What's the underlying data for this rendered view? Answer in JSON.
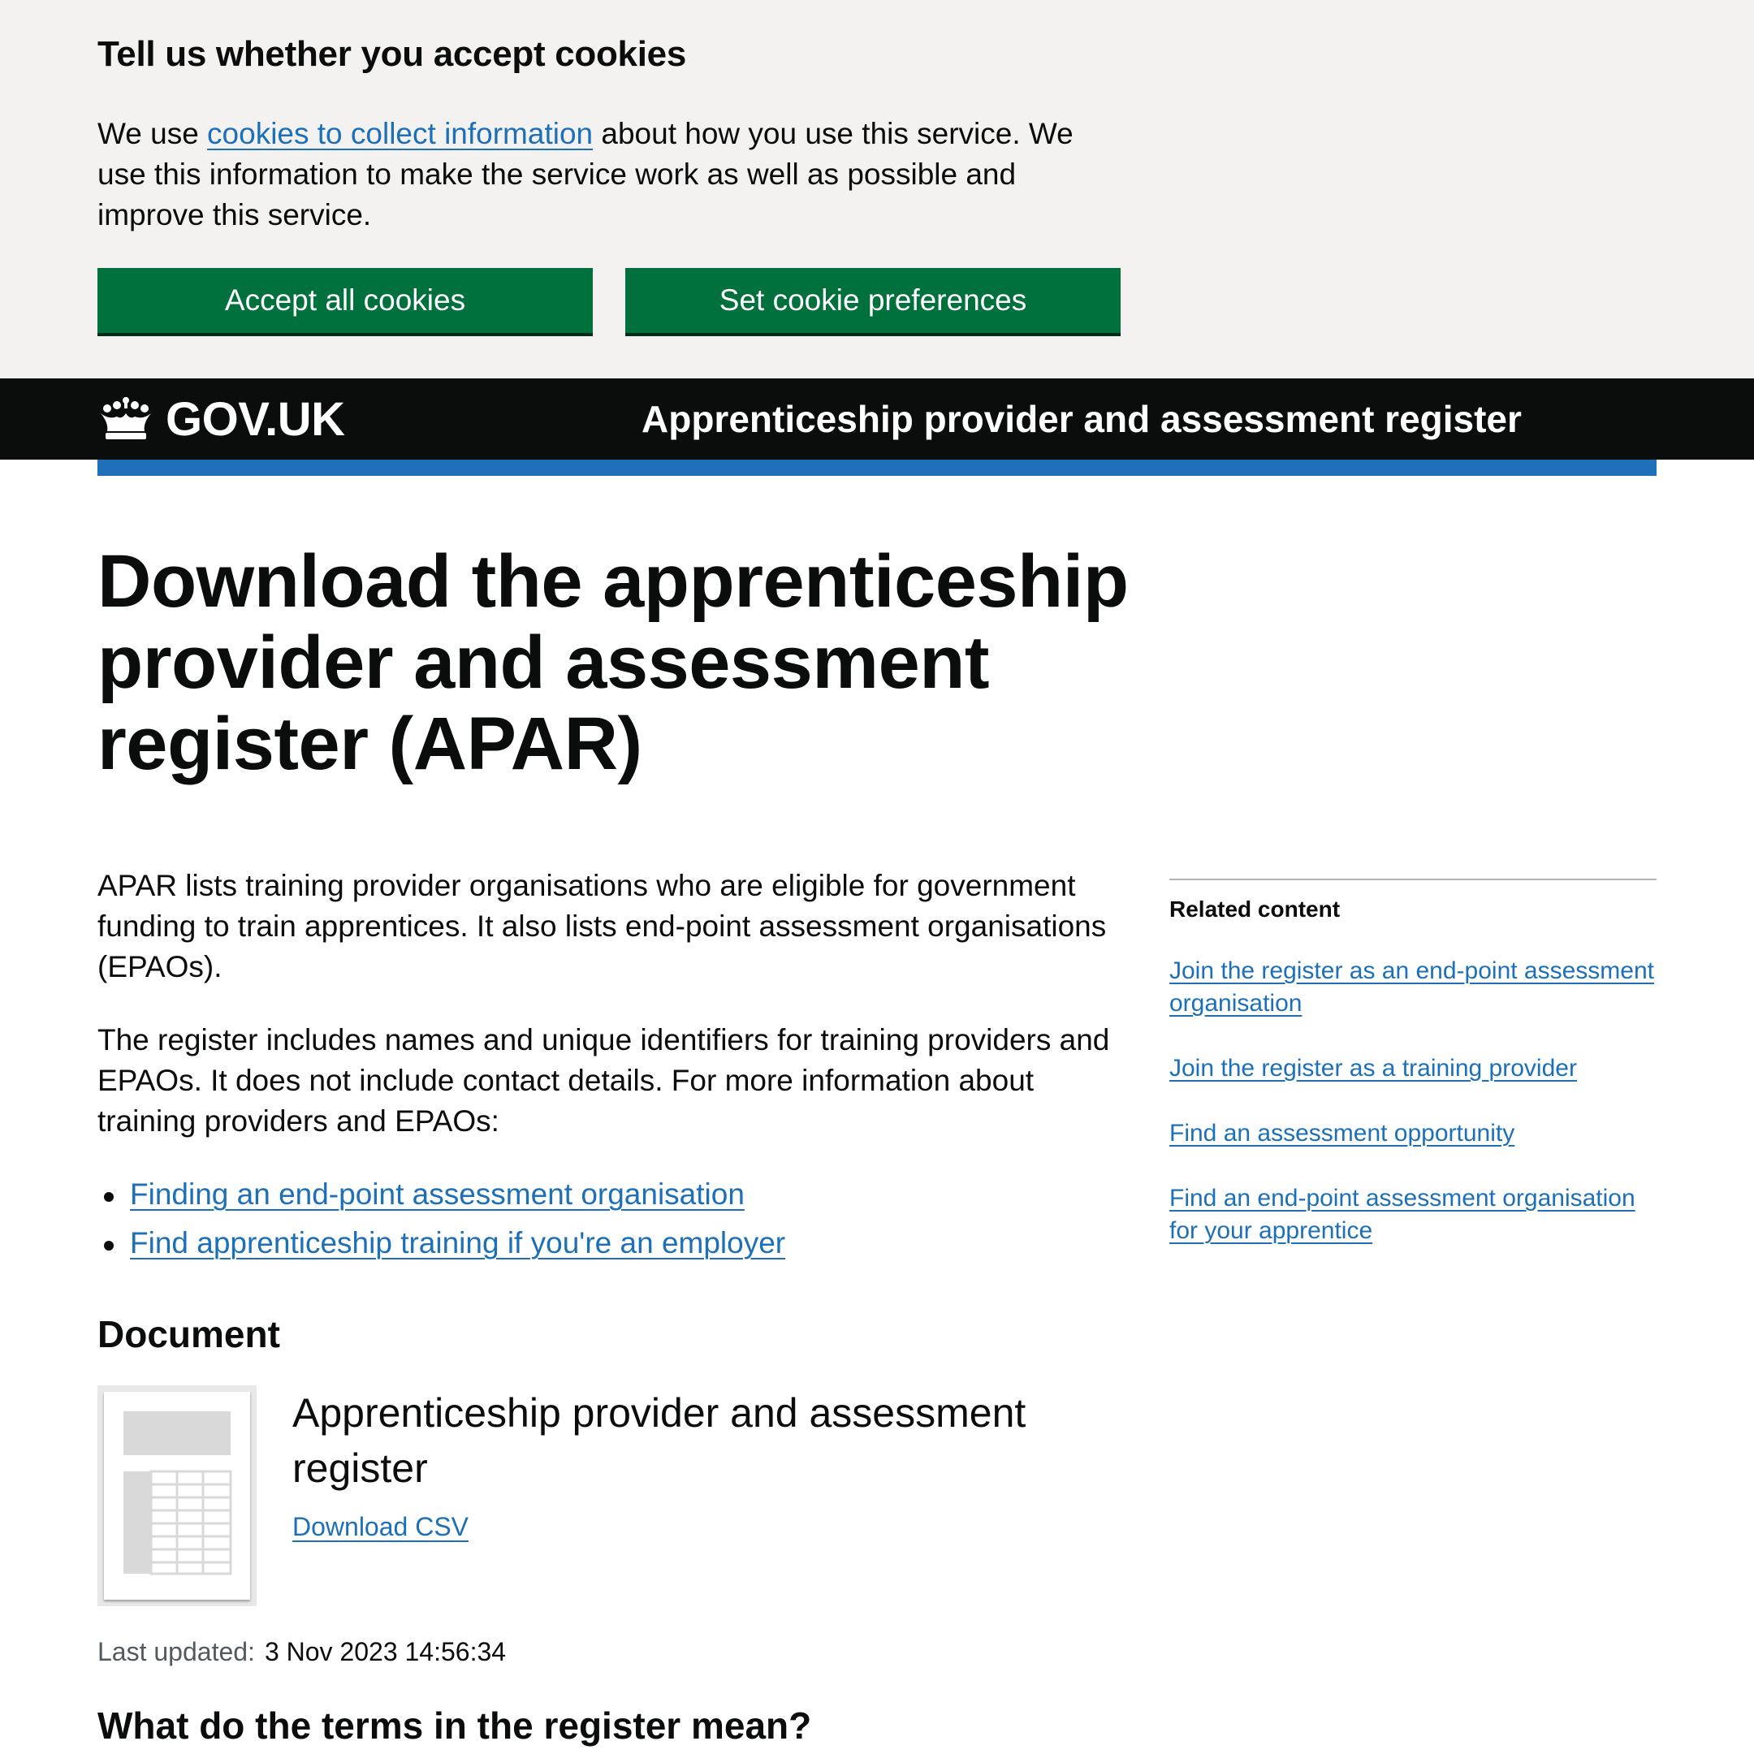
{
  "cookie_banner": {
    "heading": "Tell us whether you accept cookies",
    "text_before": "We use ",
    "link": "cookies to collect information",
    "text_after": " about how you use this service. We use this information to make the service work as well as possible and improve this service.",
    "accept_label": "Accept all cookies",
    "prefs_label": "Set cookie preferences"
  },
  "header": {
    "logo_text": "GOV.UK",
    "service_name": "Apprenticeship provider and assessment register"
  },
  "main": {
    "title": "Download the apprenticeship provider and assessment register (APAR)",
    "para1": "APAR lists training provider organisations who are eligible for government funding to train apprentices. It also lists end-point assessment organisations (EPAOs).",
    "para2": "The register includes names and unique identifiers for training providers and EPAOs. It does not include contact details. For more information about training providers and EPAOs:",
    "links": [
      "Finding an end-point assessment organisation",
      "Find apprenticeship training if you're an employer"
    ],
    "document_heading": "Document",
    "document_title": "Apprenticeship provider and assessment register",
    "download_label": "Download CSV",
    "last_updated_label": "Last updated:",
    "last_updated_value": "3 Nov 2023 14:56:34",
    "terms_heading": "What do the terms in the register mean?"
  },
  "sidebar": {
    "heading": "Related content",
    "links": [
      "Join the register as an end-point assessment organisation",
      "Join the register as a training provider",
      "Find an assessment opportunity",
      "Find an end-point assessment organisation for your apprentice"
    ]
  },
  "colors": {
    "button_green": "#00703c",
    "link_blue": "#1d70b8",
    "header_black": "#0b0c0c",
    "banner_grey": "#f3f2f1"
  }
}
